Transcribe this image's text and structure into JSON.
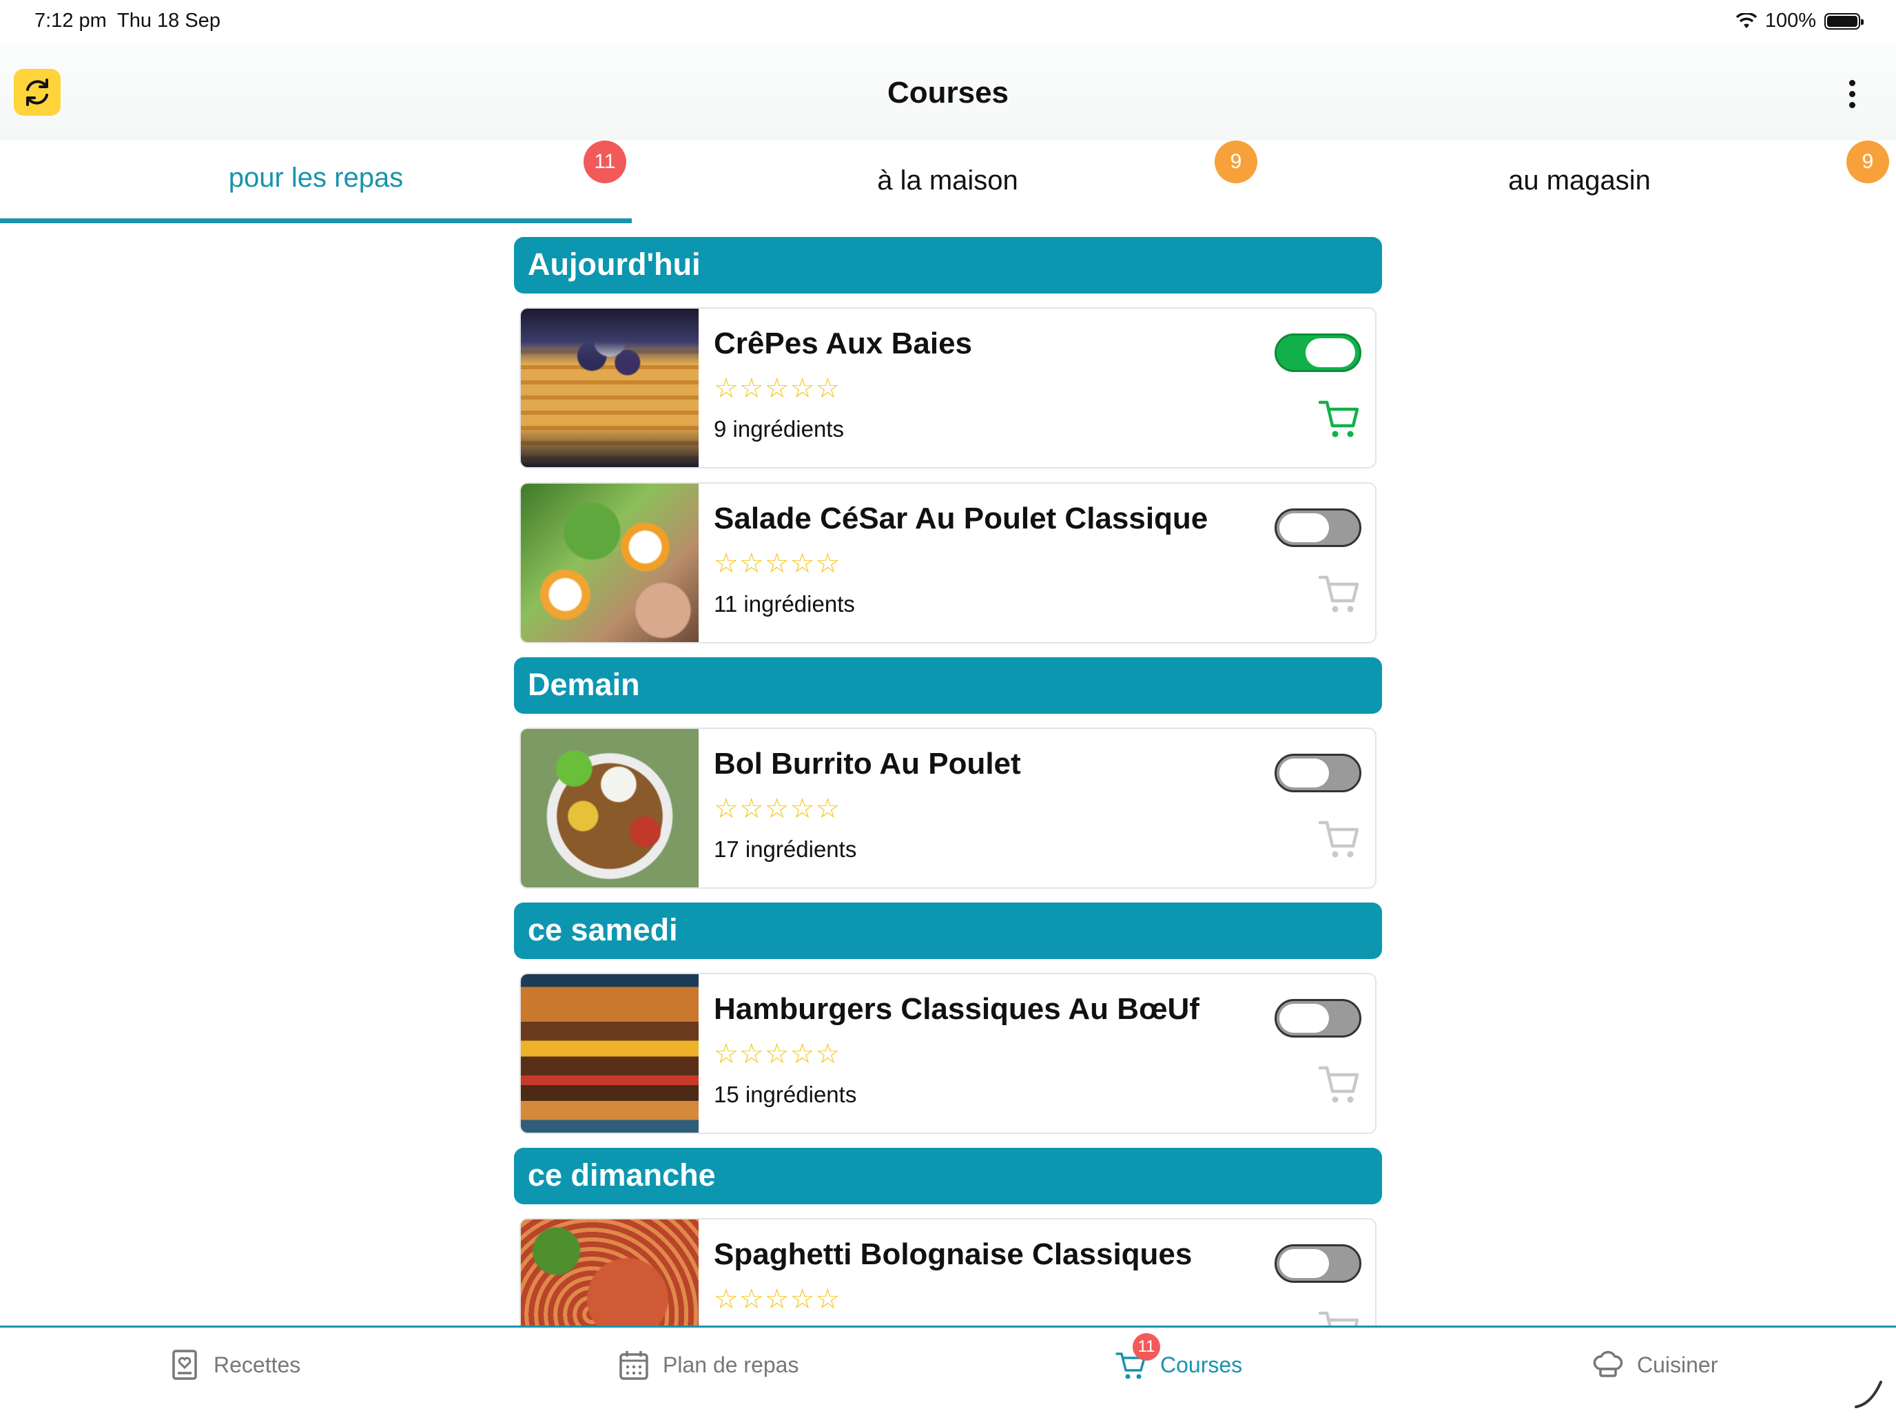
{
  "status": {
    "time": "7:12 pm",
    "date": "Thu 18 Sep",
    "battery": "100%"
  },
  "header": {
    "title": "Courses"
  },
  "tabs": [
    {
      "label": "pour les repas",
      "badge": "11",
      "active": true
    },
    {
      "label": "à la maison",
      "badge": "9",
      "active": false
    },
    {
      "label": "au magasin",
      "badge": "9",
      "active": false
    }
  ],
  "sections": [
    {
      "title": "Aujourd'hui",
      "recipes": [
        {
          "title": "CrêPes Aux Baies",
          "rating": "☆☆☆☆☆",
          "count": "9 ingrédients",
          "selected": true,
          "image": "pancakes-berries"
        },
        {
          "title": "Salade CéSar Au Poulet Classique",
          "rating": "☆☆☆☆☆",
          "count": "11 ingrédients",
          "selected": false,
          "image": "caesar-salad"
        }
      ]
    },
    {
      "title": "Demain",
      "recipes": [
        {
          "title": "Bol Burrito Au Poulet",
          "rating": "☆☆☆☆☆",
          "count": "17 ingrédients",
          "selected": false,
          "image": "burrito-bowl"
        }
      ]
    },
    {
      "title": "ce samedi",
      "recipes": [
        {
          "title": "Hamburgers Classiques Au BœUf",
          "rating": "☆☆☆☆☆",
          "count": "15 ingrédients",
          "selected": false,
          "image": "beef-burger"
        }
      ]
    },
    {
      "title": "ce dimanche",
      "recipes": [
        {
          "title": "Spaghetti Bolognaise Classiques",
          "rating": "☆☆☆☆☆",
          "count": "",
          "selected": false,
          "image": "spaghetti-bolognese"
        }
      ]
    }
  ],
  "bottom_nav": [
    {
      "label": "Recettes",
      "icon": "recipe-book-icon",
      "active": false
    },
    {
      "label": "Plan de repas",
      "icon": "calendar-icon",
      "active": false
    },
    {
      "label": "Courses",
      "icon": "cart-icon",
      "active": true,
      "badge": "11"
    },
    {
      "label": "Cuisiner",
      "icon": "chef-hat-icon",
      "active": false
    }
  ],
  "colors": {
    "accent": "#1893ae",
    "header": "#0d96b0",
    "toggle_on": "#12b04a",
    "badge_red": "#f25a5a",
    "badge_orange": "#f7a13a",
    "stars": "#f5c518"
  }
}
